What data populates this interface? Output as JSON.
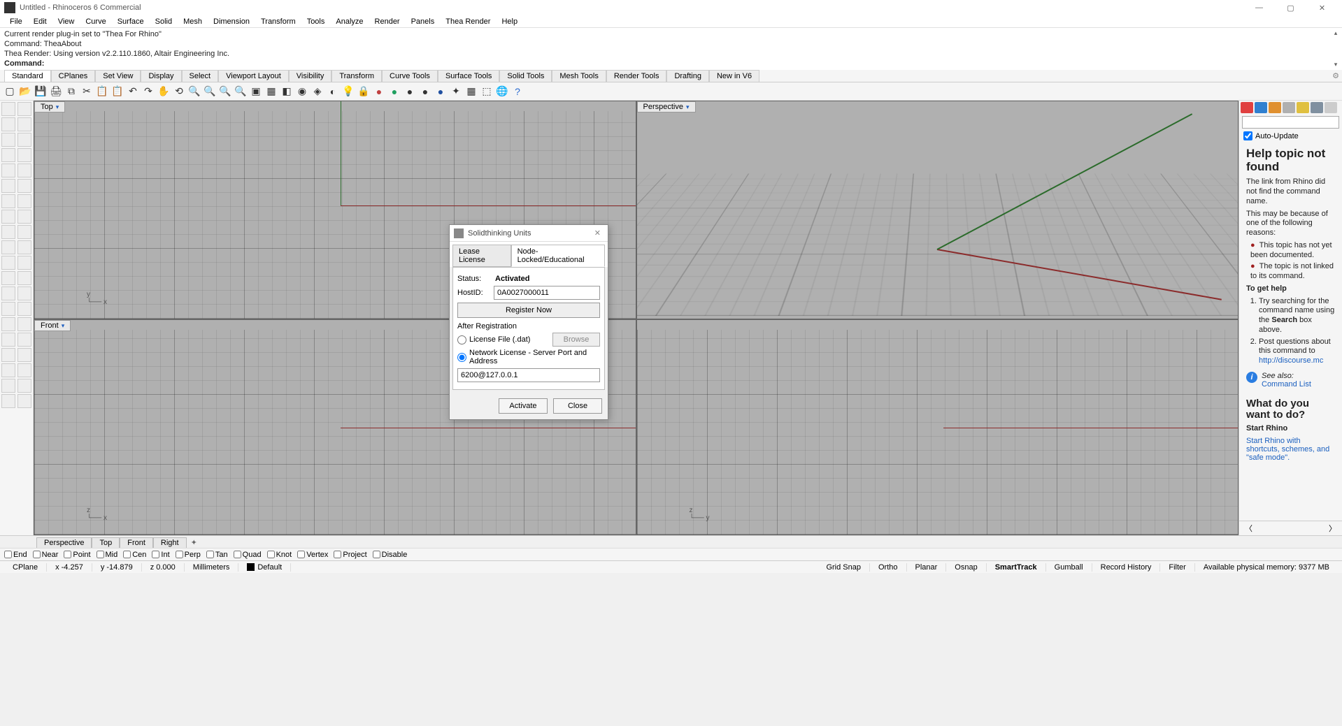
{
  "window": {
    "title": "Untitled - Rhinoceros 6 Commercial"
  },
  "menus": [
    "File",
    "Edit",
    "View",
    "Curve",
    "Surface",
    "Solid",
    "Mesh",
    "Dimension",
    "Transform",
    "Tools",
    "Analyze",
    "Render",
    "Panels",
    "Thea Render",
    "Help"
  ],
  "command_log": {
    "l1": "Current render plug-in set to \"Thea For Rhino\"",
    "l2": "Command: TheaAbout",
    "l3": "Thea Render: Using version v2.2.110.1860, Altair Engineering Inc.",
    "prompt": "Command:"
  },
  "tool_tabs": [
    "Standard",
    "CPlanes",
    "Set View",
    "Display",
    "Select",
    "Viewport Layout",
    "Visibility",
    "Transform",
    "Curve Tools",
    "Surface Tools",
    "Solid Tools",
    "Mesh Tools",
    "Render Tools",
    "Drafting",
    "New in V6"
  ],
  "viewports": {
    "tl": "Top",
    "tr": "Perspective",
    "bl": "Front",
    "br": ""
  },
  "bottom_tabs": [
    "Perspective",
    "Top",
    "Front",
    "Right"
  ],
  "osnap": [
    "End",
    "Near",
    "Point",
    "Mid",
    "Cen",
    "Int",
    "Perp",
    "Tan",
    "Quad",
    "Knot",
    "Vertex",
    "Project",
    "Disable"
  ],
  "status": {
    "cplane": "CPlane",
    "x": "x -4.257",
    "y": "y -14.879",
    "z": "z 0.000",
    "units": "Millimeters",
    "layer": "Default",
    "items": [
      "Grid Snap",
      "Ortho",
      "Planar",
      "Osnap",
      "SmartTrack",
      "Gumball",
      "Record History",
      "Filter"
    ],
    "active_item": "SmartTrack",
    "mem": "Available physical memory: 9377 MB"
  },
  "help": {
    "auto_update": "Auto-Update",
    "h1": "Help topic not found",
    "p1": "The link from Rhino did not find the command name.",
    "p2": "This may be because of one of the following reasons:",
    "r1": "This topic has not yet been documented.",
    "r2": "The topic is not linked to its command.",
    "h2": "To get help",
    "o1a": "Try searching for the command name using the ",
    "o1b": "Search",
    "o1c": " box above.",
    "o2a": "Post questions about this command to ",
    "o2link": "http://discourse.mc",
    "see": "See also:",
    "cmdlist": "Command List",
    "h3": "What do you want to do?",
    "start_h": "Start Rhino",
    "start_link": "Start Rhino with shortcuts, schemes, and \"safe mode\"."
  },
  "dialog": {
    "title": "Solidthinking Units",
    "tab1": "Lease License",
    "tab2": "Node-Locked/Educational",
    "status_label": "Status:",
    "status_value": "Activated",
    "hostid_label": "HostID:",
    "hostid_value": "0A0027000011",
    "register": "Register Now",
    "after": "After Registration",
    "radio1": "License File (.dat)",
    "browse": "Browse",
    "radio2": "Network License - Server Port and Address",
    "server": "6200@127.0.0.1",
    "activate": "Activate",
    "close": "Close"
  }
}
